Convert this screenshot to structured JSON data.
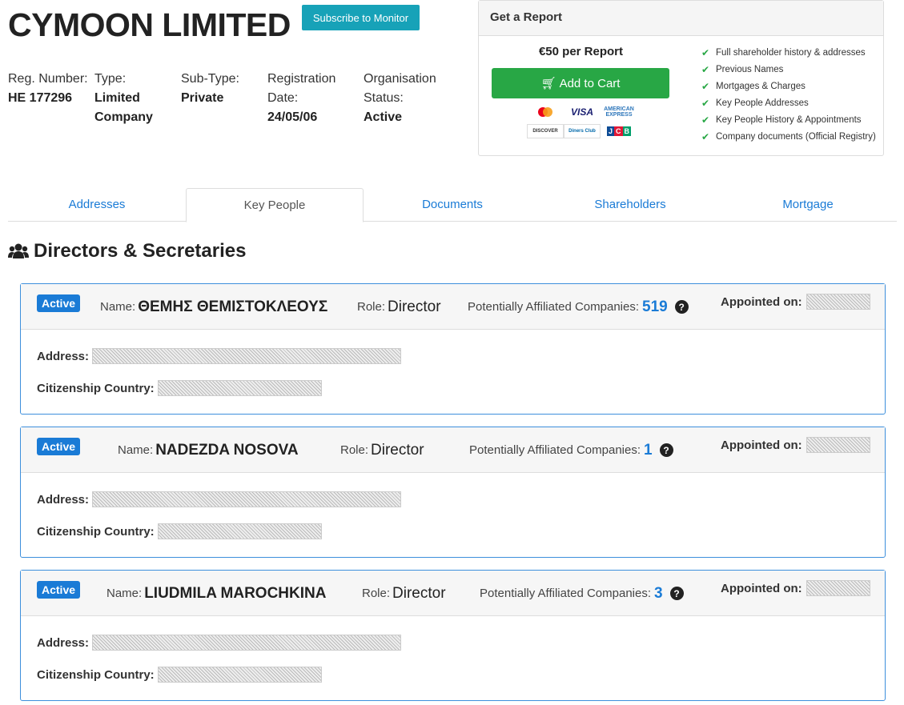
{
  "company": {
    "name": "CYMOON LIMITED",
    "subscribe_label": "Subscribe to Monitor"
  },
  "info": [
    {
      "label": "Reg. Number:",
      "value": "HE 177296"
    },
    {
      "label": "Type:",
      "value": "Limited Company"
    },
    {
      "label": "Sub-Type:",
      "value": "Private"
    },
    {
      "label": "Registration Date:",
      "value": "24/05/06"
    },
    {
      "label": "Organisation Status:",
      "value": "Active"
    }
  ],
  "report": {
    "title": "Get a Report",
    "price": "€50 per Report",
    "cart_label": "Add to Cart",
    "cards": [
      "mastercard",
      "VISA",
      "AMERICAN EXPRESS",
      "DISCOVER",
      "Diners Club",
      "JCB"
    ],
    "features": [
      "Full shareholder history & addresses",
      "Previous Names",
      "Mortgages & Charges",
      "Key People Addresses",
      "Key People History & Appointments",
      "Company documents (Official Registry)"
    ]
  },
  "tabs": [
    "Addresses",
    "Key People",
    "Documents",
    "Shareholders",
    "Mortgage"
  ],
  "section_title": "Directors & Secretaries",
  "labels": {
    "name": "Name:",
    "role": "Role:",
    "affiliated": "Potentially Affiliated Companies:",
    "appointed": "Appointed on:",
    "address": "Address:",
    "citizenship": "Citizenship Country:",
    "help": "?"
  },
  "people": [
    {
      "status": "Active",
      "name": "ΘΕΜΗΣ ΘΕΜΙΣΤΟΚΛΕΟΥΣ",
      "role": "Director",
      "affiliated": "519"
    },
    {
      "status": "Active",
      "name": "NADEZDA NOSOVA",
      "role": "Director",
      "affiliated": "1"
    },
    {
      "status": "Active",
      "name": "LIUDMILA MAROCHKINA",
      "role": "Director",
      "affiliated": "3"
    }
  ],
  "colors": {
    "link": "#1a7bd6",
    "cart": "#28a745",
    "subscribe": "#17a2b8"
  }
}
